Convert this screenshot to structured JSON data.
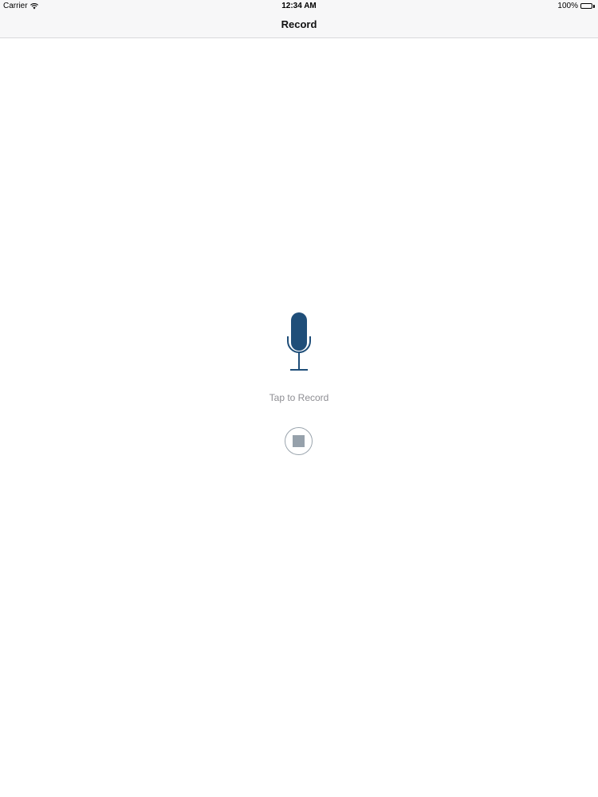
{
  "status_bar": {
    "carrier": "Carrier",
    "time": "12:34 AM",
    "battery_percent": "100%",
    "battery_level": 1.0,
    "icons": [
      "wifi-icon",
      "battery-icon"
    ]
  },
  "nav_bar": {
    "title": "Record"
  },
  "recorder": {
    "mic_icon": "microphone-icon",
    "hint": "Tap to Record",
    "stop_icon": "stop-icon"
  },
  "colors": {
    "mic": "#1f4e79",
    "hint_text": "#8e8e93",
    "stop": "#96a1ab",
    "chrome_background": "#f7f7f8"
  }
}
